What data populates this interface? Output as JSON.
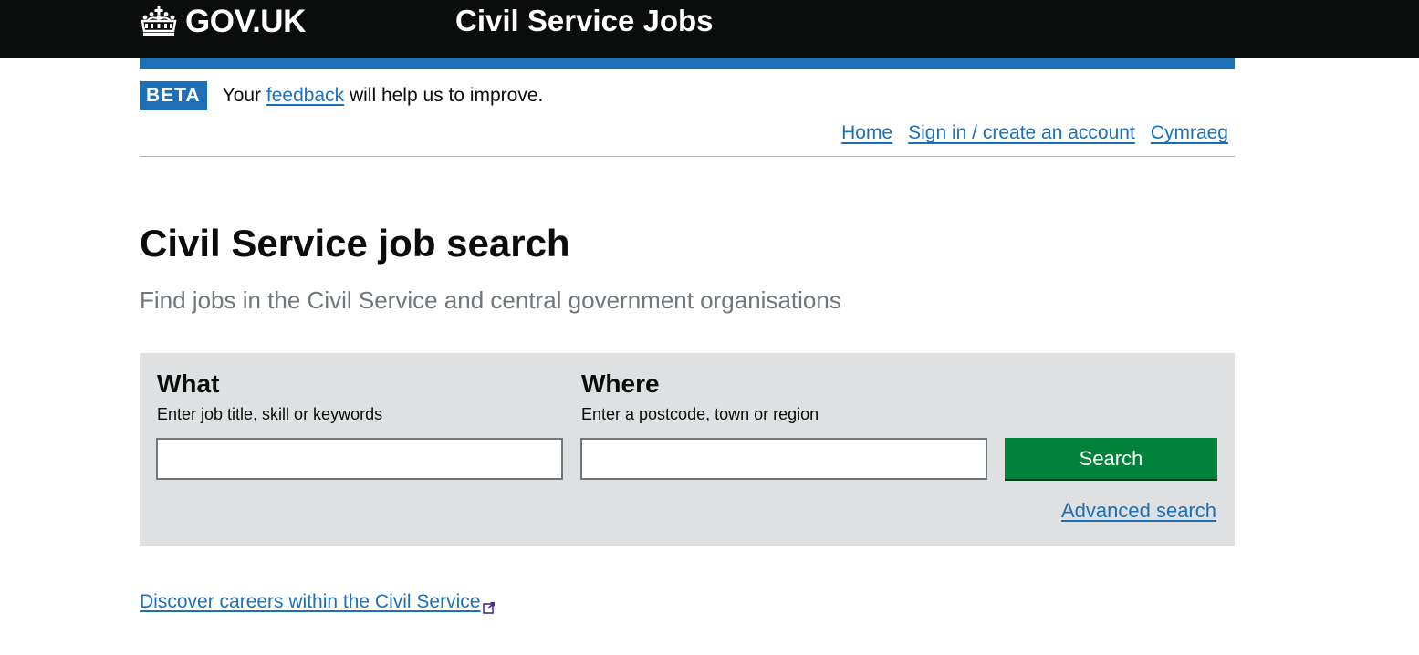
{
  "header": {
    "logo_text": "GOV.UK",
    "service_name": "Civil Service Jobs"
  },
  "beta_banner": {
    "tag": "BETA",
    "text_before": "Your ",
    "link_text": "feedback",
    "text_after": " will help us to improve."
  },
  "top_nav": {
    "items": [
      {
        "label": "Home"
      },
      {
        "label": "Sign in / create an account"
      },
      {
        "label": "Cymraeg"
      }
    ]
  },
  "main": {
    "title": "Civil Service job search",
    "subtitle": "Find jobs in the Civil Service and central government organisations"
  },
  "search": {
    "what_label": "What",
    "what_hint": "Enter job title, skill or keywords",
    "what_value": "",
    "where_label": "Where",
    "where_hint": "Enter a postcode, town or region",
    "where_value": "",
    "button_label": "Search",
    "advanced_link": "Advanced search"
  },
  "careers_link": "Discover careers within the Civil Service",
  "colors": {
    "header_bg": "#0b0c0c",
    "link": "#1d70b8",
    "beta_tag": "#1d70b8",
    "search_panel_bg": "#dee0e2",
    "search_button": "#00823b",
    "subtitle": "#6f777b"
  },
  "icons": {
    "logo": "crown-icon",
    "external": "external-link-icon"
  }
}
